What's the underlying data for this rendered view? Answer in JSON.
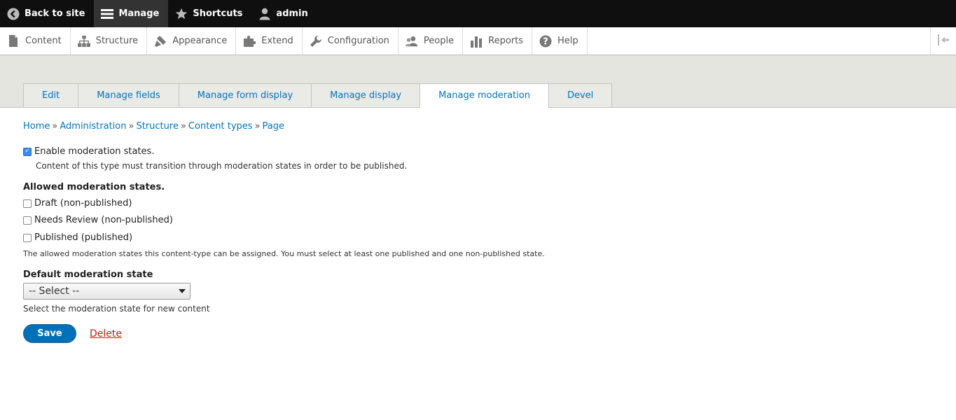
{
  "toolbar": {
    "back_label": "Back to site",
    "manage_label": "Manage",
    "shortcuts_label": "Shortcuts",
    "user_label": "admin"
  },
  "tray": {
    "items": [
      {
        "label": "Content",
        "icon": "file-icon"
      },
      {
        "label": "Structure",
        "icon": "sitemap-icon"
      },
      {
        "label": "Appearance",
        "icon": "paintbrush-icon"
      },
      {
        "label": "Extend",
        "icon": "puzzle-icon"
      },
      {
        "label": "Configuration",
        "icon": "wrench-icon"
      },
      {
        "label": "People",
        "icon": "people-icon"
      },
      {
        "label": "Reports",
        "icon": "bar-chart-icon"
      },
      {
        "label": "Help",
        "icon": "help-icon"
      }
    ]
  },
  "tabs": [
    {
      "label": "Edit",
      "active": false
    },
    {
      "label": "Manage fields",
      "active": false
    },
    {
      "label": "Manage form display",
      "active": false
    },
    {
      "label": "Manage display",
      "active": false
    },
    {
      "label": "Manage moderation",
      "active": true
    },
    {
      "label": "Devel",
      "active": false
    }
  ],
  "breadcrumb": [
    "Home",
    "Administration",
    "Structure",
    "Content types",
    "Page"
  ],
  "breadcrumb_separator": "»",
  "enable": {
    "label": "Enable moderation states.",
    "checked": true,
    "description": "Content of this type must transition through moderation states in order to be published."
  },
  "allowed": {
    "title": "Allowed moderation states.",
    "options": [
      {
        "label": "Draft (non-published)",
        "checked": false
      },
      {
        "label": "Needs Review (non-published)",
        "checked": false
      },
      {
        "label": "Published (published)",
        "checked": false
      }
    ],
    "description": "The allowed moderation states this content-type can be assigned. You must select at least one published and one non-published state."
  },
  "default_state": {
    "label": "Default moderation state",
    "selected": "-- Select --",
    "description": "Select the moderation state for new content"
  },
  "actions": {
    "save_label": "Save",
    "delete_label": "Delete"
  },
  "colors": {
    "link": "#0074bd",
    "primary_button": "#0071b8",
    "delete": "#c72100",
    "toolbar_bg": "#0f0f0f"
  }
}
